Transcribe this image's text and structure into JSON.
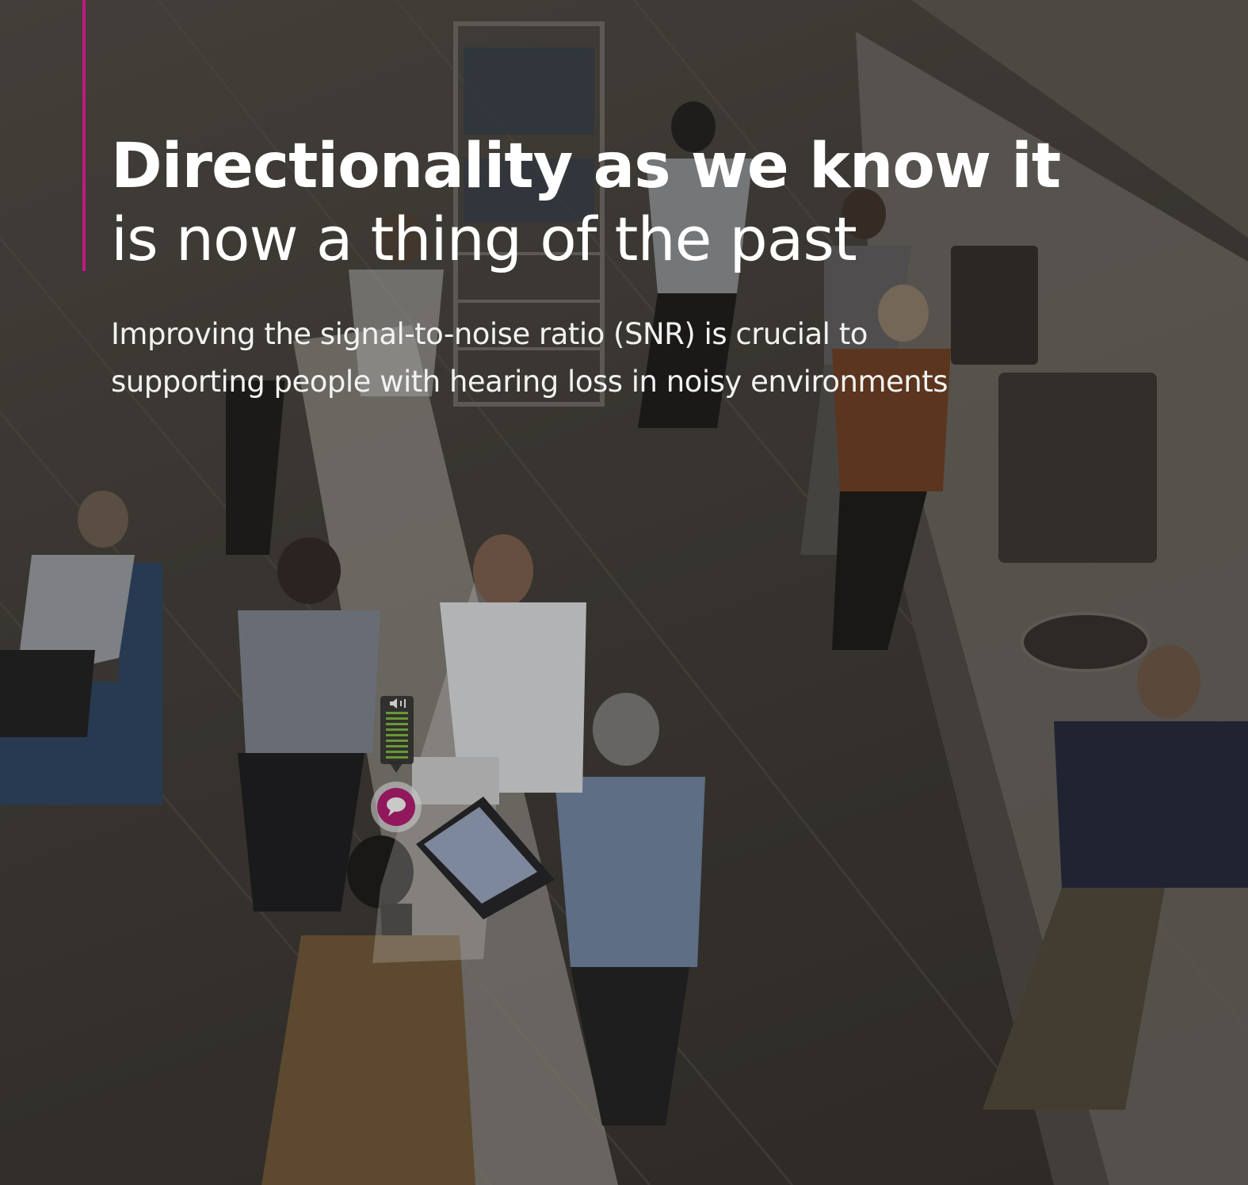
{
  "headline": {
    "line_bold": "Directionality as we know it",
    "line_light": "is now a thing of the past"
  },
  "subheading": {
    "line1": "Improving the signal-to-noise ratio (SNR) is crucial to",
    "line2": "supporting people with hearing loss in noisy environments"
  },
  "colors": {
    "accent": "#c0197f",
    "text": "#ffffff",
    "overlay": "#3a3733",
    "level_meter": "#7bbf3a"
  },
  "icons": [
    "speaker-icon",
    "speech-bubble-icon"
  ]
}
